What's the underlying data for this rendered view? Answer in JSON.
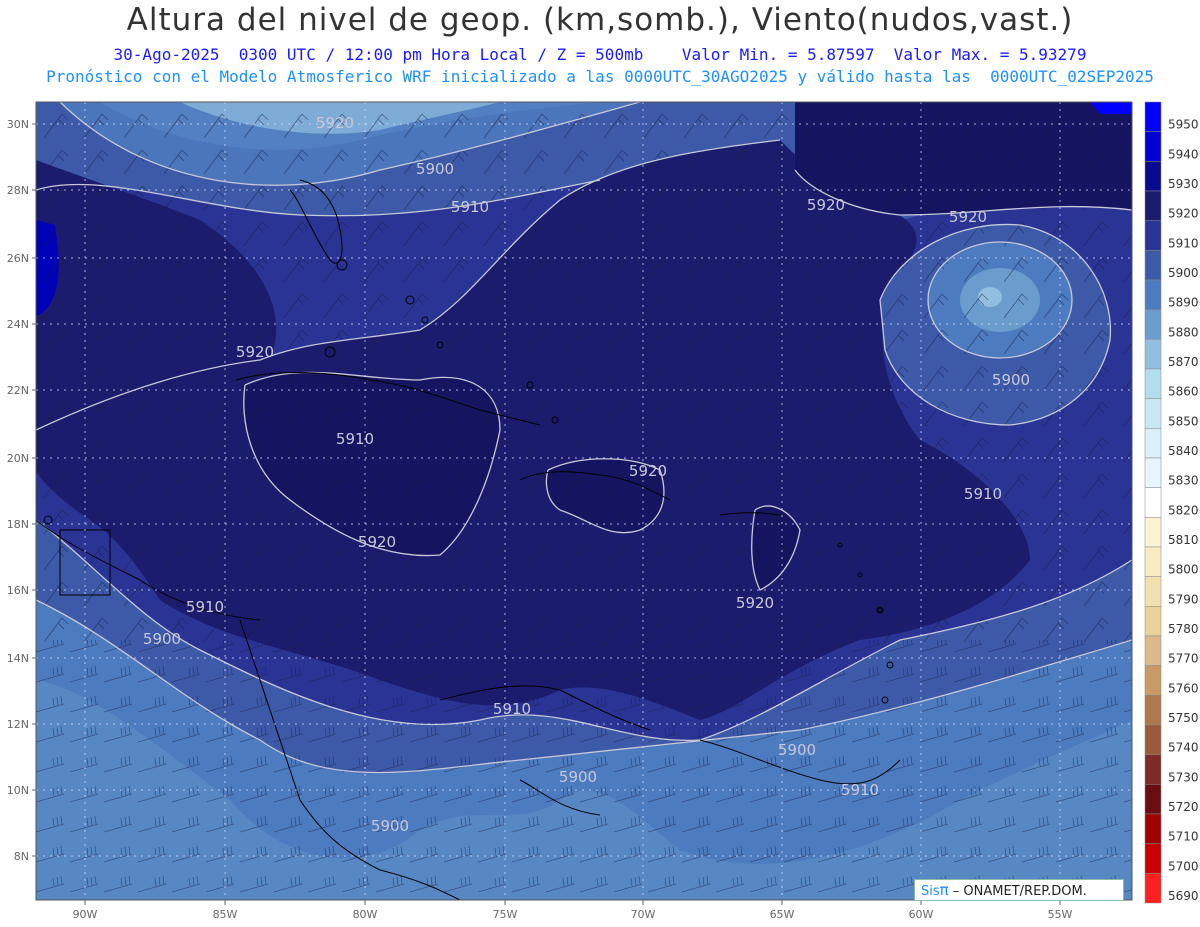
{
  "header": {
    "title": "Altura del nivel de geop. (km,somb.), Viento(nudos,vast.)",
    "subtitle_date": "30-Ago-2025  0300 UTC / 12:00 pm Hora Local / Z = 500mb    Valor Min. = 5.87597  Valor Max. = 5.93279",
    "subtitle_model": "Pronóstico con el Modelo Atmosferico WRF inicializado a las 0000UTC_30AGO2025 y válido hasta las  0000UTC_02SEP2025"
  },
  "map": {
    "lat_labels": [
      "30N",
      "28N",
      "26N",
      "24N",
      "22N",
      "20N",
      "18N",
      "16N",
      "14N",
      "12N",
      "10N",
      "8N"
    ],
    "lon_labels": [
      "90W",
      "85W",
      "80W",
      "75W",
      "70W",
      "65W",
      "60W",
      "55W"
    ],
    "contour_labels": [
      "5920",
      "5900",
      "5910",
      "5920",
      "5910",
      "5920",
      "5920",
      "5900",
      "5920",
      "5910",
      "5920",
      "5910",
      "5900",
      "5910",
      "5920",
      "5900",
      "5900",
      "5900",
      "5910"
    ],
    "colors": {
      "c5950": "#0000ff",
      "c5940": "#0000cd",
      "c5930": "#0d0d8a",
      "c5920": "#1a1a70",
      "c5910": "#2a3494",
      "c5900": "#3d5aa8",
      "c5890": "#4d7bbf",
      "c5880": "#6699cc",
      "c5870": "#8bb8dd"
    }
  },
  "legend": {
    "items": [
      {
        "value": "5950",
        "color": "#0000ff"
      },
      {
        "value": "5940",
        "color": "#0000d0"
      },
      {
        "value": "5930",
        "color": "#0a0a90"
      },
      {
        "value": "5920",
        "color": "#1c1c6e"
      },
      {
        "value": "5910",
        "color": "#2a3494"
      },
      {
        "value": "5900",
        "color": "#3d5aa8"
      },
      {
        "value": "5890",
        "color": "#4d7bbf"
      },
      {
        "value": "5880",
        "color": "#6a9ccd"
      },
      {
        "value": "5870",
        "color": "#92bfe0"
      },
      {
        "value": "5860",
        "color": "#b4dcef"
      },
      {
        "value": "5850",
        "color": "#c8e8f5"
      },
      {
        "value": "5840",
        "color": "#d8f0fa"
      },
      {
        "value": "5830",
        "color": "#e6f6fc"
      },
      {
        "value": "5820",
        "color": "#ffffff"
      },
      {
        "value": "5810",
        "color": "#fbf3d2"
      },
      {
        "value": "5800",
        "color": "#f8ebc2"
      },
      {
        "value": "5790",
        "color": "#f3e0b0"
      },
      {
        "value": "5780",
        "color": "#ead29a"
      },
      {
        "value": "5770",
        "color": "#dcb98a"
      },
      {
        "value": "5760",
        "color": "#c79a66"
      },
      {
        "value": "5750",
        "color": "#b07850"
      },
      {
        "value": "5740",
        "color": "#9a5a3c"
      },
      {
        "value": "5730",
        "color": "#7e2a28"
      },
      {
        "value": "5720",
        "color": "#6b0e12"
      },
      {
        "value": "5710",
        "color": "#a00000"
      },
      {
        "value": "5700",
        "color": "#c80000"
      },
      {
        "value": "5690",
        "color": "#ff2020"
      }
    ]
  },
  "footer": {
    "sis": "Sis",
    "pi": "π",
    "credit": " – ONAMET/REP.DOM."
  }
}
